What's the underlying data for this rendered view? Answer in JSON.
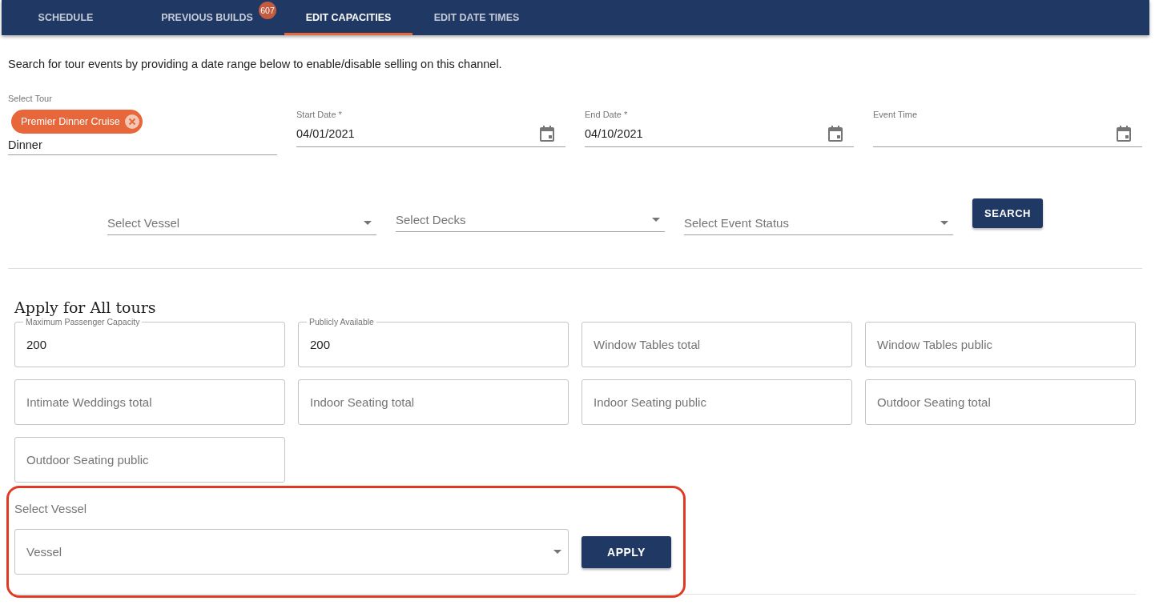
{
  "tabs": [
    {
      "label": "SCHEDULE",
      "selected": false
    },
    {
      "label": "PREVIOUS BUILDS",
      "selected": false,
      "badge": "607"
    },
    {
      "label": "EDIT CAPACITIES",
      "selected": true
    },
    {
      "label": "EDIT DATE TIMES",
      "selected": false
    }
  ],
  "intro": "Search for tour events by providing a date range below to enable/disable selling on this channel.",
  "tour": {
    "label": "Select Tour",
    "chip": "Premier Dinner Cruise",
    "value": "Dinner"
  },
  "date_fields": [
    {
      "label": "Start Date *",
      "value": "04/01/2021"
    },
    {
      "label": "End Date *",
      "value": "04/10/2021"
    },
    {
      "label": "Event Time"
    }
  ],
  "selects": [
    {
      "placeholder": "Select Vessel"
    },
    {
      "placeholder": "Select Decks"
    },
    {
      "placeholder": "Select Event Status"
    }
  ],
  "search_button": "SEARCH",
  "apply": {
    "heading": "Apply for All tours",
    "fields": [
      {
        "label": "Maximum Passenger Capacity",
        "value": "200"
      },
      {
        "label": "Publicly Available",
        "value": "200"
      },
      {
        "placeholder": "Window Tables total"
      },
      {
        "placeholder": "Window Tables public"
      },
      {
        "placeholder": "Intimate Weddings total"
      },
      {
        "placeholder": "Indoor Seating total"
      },
      {
        "placeholder": "Indoor Seating public"
      },
      {
        "placeholder": "Outdoor Seating total"
      },
      {
        "placeholder": "Outdoor Seating public"
      }
    ],
    "vessel_label": "Select Vessel",
    "vessel_placeholder": "Vessel",
    "button": "APPLY"
  }
}
